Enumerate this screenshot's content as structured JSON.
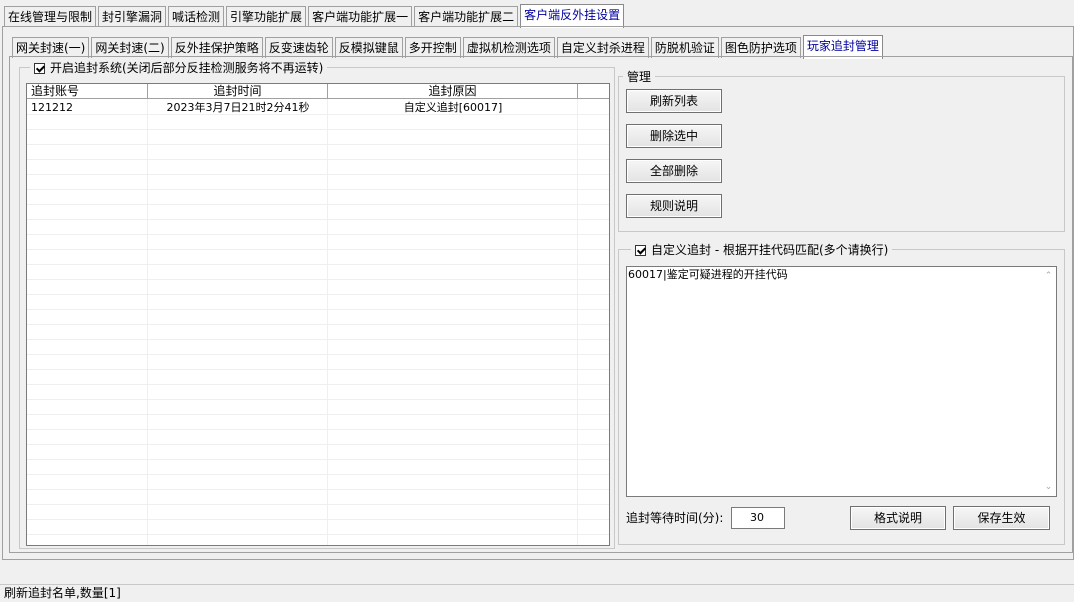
{
  "top_tabs": [
    {
      "label": "在线管理与限制"
    },
    {
      "label": "封引擎漏洞"
    },
    {
      "label": "喊话检测"
    },
    {
      "label": "引擎功能扩展"
    },
    {
      "label": "客户端功能扩展一"
    },
    {
      "label": "客户端功能扩展二"
    },
    {
      "label": "客户端反外挂设置"
    }
  ],
  "sub_tabs": [
    {
      "label": "网关封速(一)"
    },
    {
      "label": "网关封速(二)"
    },
    {
      "label": "反外挂保护策略"
    },
    {
      "label": "反变速齿轮"
    },
    {
      "label": "反模拟键鼠"
    },
    {
      "label": "多开控制"
    },
    {
      "label": "虚拟机检测选项"
    },
    {
      "label": "自定义封杀进程"
    },
    {
      "label": "防脱机验证"
    },
    {
      "label": "图色防护选项"
    },
    {
      "label": "玩家追封管理"
    }
  ],
  "enable_group": {
    "label": "开启追封系统(关闭后部分反挂检测服务将不再运转)",
    "checked": true
  },
  "table": {
    "columns": [
      "追封账号",
      "追封时间",
      "追封原因"
    ],
    "rows": [
      {
        "account": "121212",
        "time": "2023年3月7日21时2分41秒",
        "reason": "自定义追封[60017]"
      }
    ]
  },
  "manage": {
    "title": "管理",
    "refresh": "刷新列表",
    "delete_selected": "删除选中",
    "delete_all": "全部删除",
    "rules": "规则说明"
  },
  "custom": {
    "label": "自定义追封 - 根据开挂代码匹配(多个请换行)",
    "checked": true,
    "content": "60017|鉴定可疑进程的开挂代码",
    "wait_label": "追封等待时间(分):",
    "wait_value": "30",
    "format_btn": "格式说明",
    "save_btn": "保存生效"
  },
  "status_text": "刷新追封名单,数量[1]"
}
